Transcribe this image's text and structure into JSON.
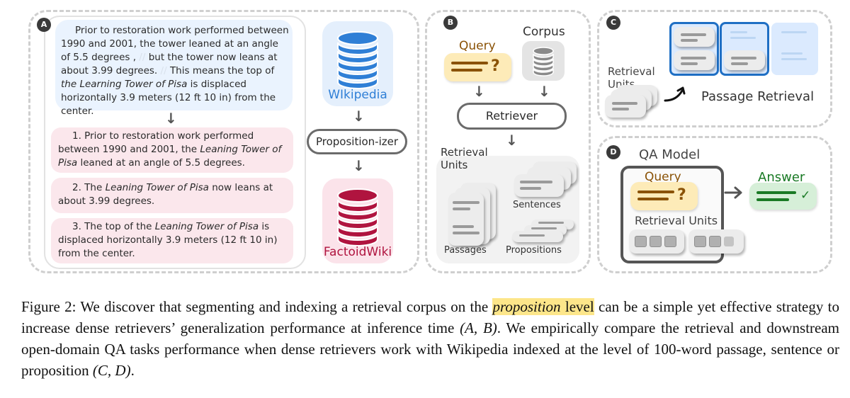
{
  "panels": {
    "A": {
      "badge": "A",
      "source_text": [
        "Prior to restoration work performed between 1990 and 2001, the tower leaned at an angle of 5.5 degrees ,",
        "//",
        "but the tower now leans at about 3.99 degrees.",
        "//",
        "This means the top of",
        "the",
        "Learning Tower of Pisa",
        "is displaced horizontally 3.9 meters (12 ft 10 in) from the center."
      ],
      "propositions": [
        {
          "pre": "1. Prior to restoration work performed between 1990 and 2001, the ",
          "italic": "Leaning Tower of Pisa",
          "post": " leaned at an angle of 5.5 degrees."
        },
        {
          "pre": "2. The ",
          "italic": "Leaning Tower of Pisa",
          "post": " now leans at about 3.99 degrees."
        },
        {
          "pre": "3. The top of the ",
          "italic": "Leaning Tower of Pisa",
          "post": " is displaced horizontally 3.9 meters (12 ft 10 in) from the center."
        }
      ],
      "source_db_label": "WIkipedia",
      "processor_label": "Proposition-izer",
      "target_db_label": "FactoidWiki",
      "colors": {
        "wikipedia": "#2f7fd6",
        "factoidwiki": "#b0143f"
      }
    },
    "B": {
      "badge": "B",
      "query_label": "Query",
      "corpus_label": "Corpus",
      "retriever_label": "Retriever",
      "units_label": "Retrieval Units",
      "units": [
        "Passages",
        "Sentences",
        "Propositions"
      ],
      "colors": {
        "query": "#8a5206",
        "query_bg": "#fdebb8"
      }
    },
    "C": {
      "badge": "C",
      "units_label": "Retrieval Units",
      "task_label": "Passage Retrieval",
      "colors": {
        "passage_border": "#1f6fc4",
        "passage_bg": "#dbeafe"
      }
    },
    "D": {
      "badge": "D",
      "model_label": "QA Model",
      "query_label": "Query",
      "units_label": "Retrieval Units",
      "answer_label": "Answer",
      "colors": {
        "answer": "#1a7a25",
        "answer_bg": "#d6efd8"
      }
    }
  },
  "caption": {
    "prefix": "Figure 2: We discover that segmenting and indexing a retrieval corpus on the ",
    "highlight_italic": "proposition",
    "highlight_rest": " level",
    "middle": " can be a simple yet effective strategy to increase dense retrievers’ generalization performance at inference time ",
    "ref1": "(A, B)",
    "middle2": ". We empirically compare the retrieval and downstream open-domain QA tasks performance when dense retrievers work with Wikipedia indexed at the level of 100-word passage, sentence or proposition ",
    "ref2": "(C, D)",
    "suffix": "."
  }
}
